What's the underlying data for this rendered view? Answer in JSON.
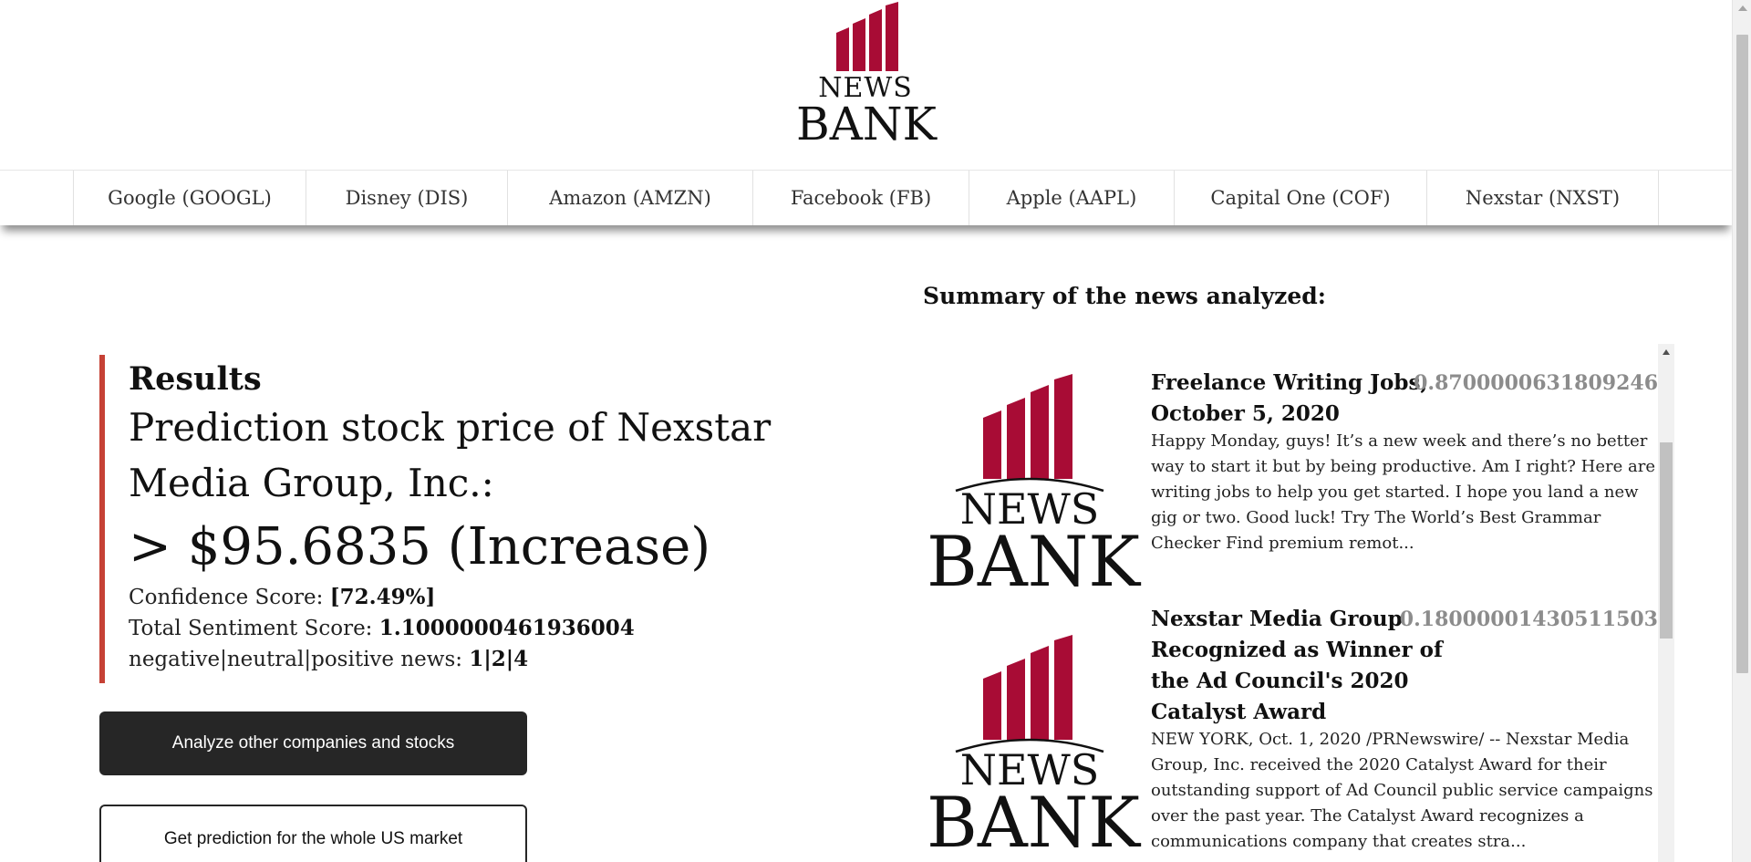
{
  "logo": {
    "line1": "NEWS",
    "line2": "BANK",
    "bar_color": "#a80c35"
  },
  "nav": {
    "items": [
      {
        "label": "Google (GOOGL)"
      },
      {
        "label": "Disney (DIS)"
      },
      {
        "label": "Amazon (AMZN)"
      },
      {
        "label": "Facebook (FB)"
      },
      {
        "label": "Apple (AAPL)"
      },
      {
        "label": "Capital One (COF)"
      },
      {
        "label": "Nexstar (NXST)"
      }
    ]
  },
  "results": {
    "title": "Results",
    "prediction_label": "Prediction stock price of Nexstar Media Group, Inc.:",
    "prediction_value": "> $95.6835 (Increase)",
    "confidence_label": "Confidence Score: ",
    "confidence_value": "[72.49%]",
    "sentiment_label": "Total Sentiment Score: ",
    "sentiment_value": "1.1000000461936004",
    "counts_label": "negative|neutral|positive news: ",
    "counts_value": "1|2|4",
    "accent_color": "#c64135"
  },
  "buttons": {
    "analyze": "Analyze other companies and stocks",
    "whole_market": "Get prediction for the whole US market"
  },
  "summary": {
    "heading": "Summary of the news analyzed:",
    "items": [
      {
        "title": "Freelance Writing Jobs, October 5, 2020",
        "score": "0.8700000631809246",
        "body": "Happy Monday, guys! It’s a new week and there’s no better way to start it but by being productive. Am I right? Here are writing jobs to help you get started. I hope you land a new gig or two. Good luck! Try The World’s Best Grammar Checker  Find premium remot..."
      },
      {
        "title": "Nexstar Media Group Recognized as Winner of the Ad Council's 2020 Catalyst Award",
        "score": "0.18000001430511503",
        "body": "NEW YORK, Oct. 1, 2020 /PRNewswire/ -- Nexstar Media Group, Inc. received the 2020 Catalyst Award for their outstanding support of Ad Council public service campaigns over the past year. The Catalyst Award recognizes a communications company that creates stra..."
      }
    ]
  }
}
